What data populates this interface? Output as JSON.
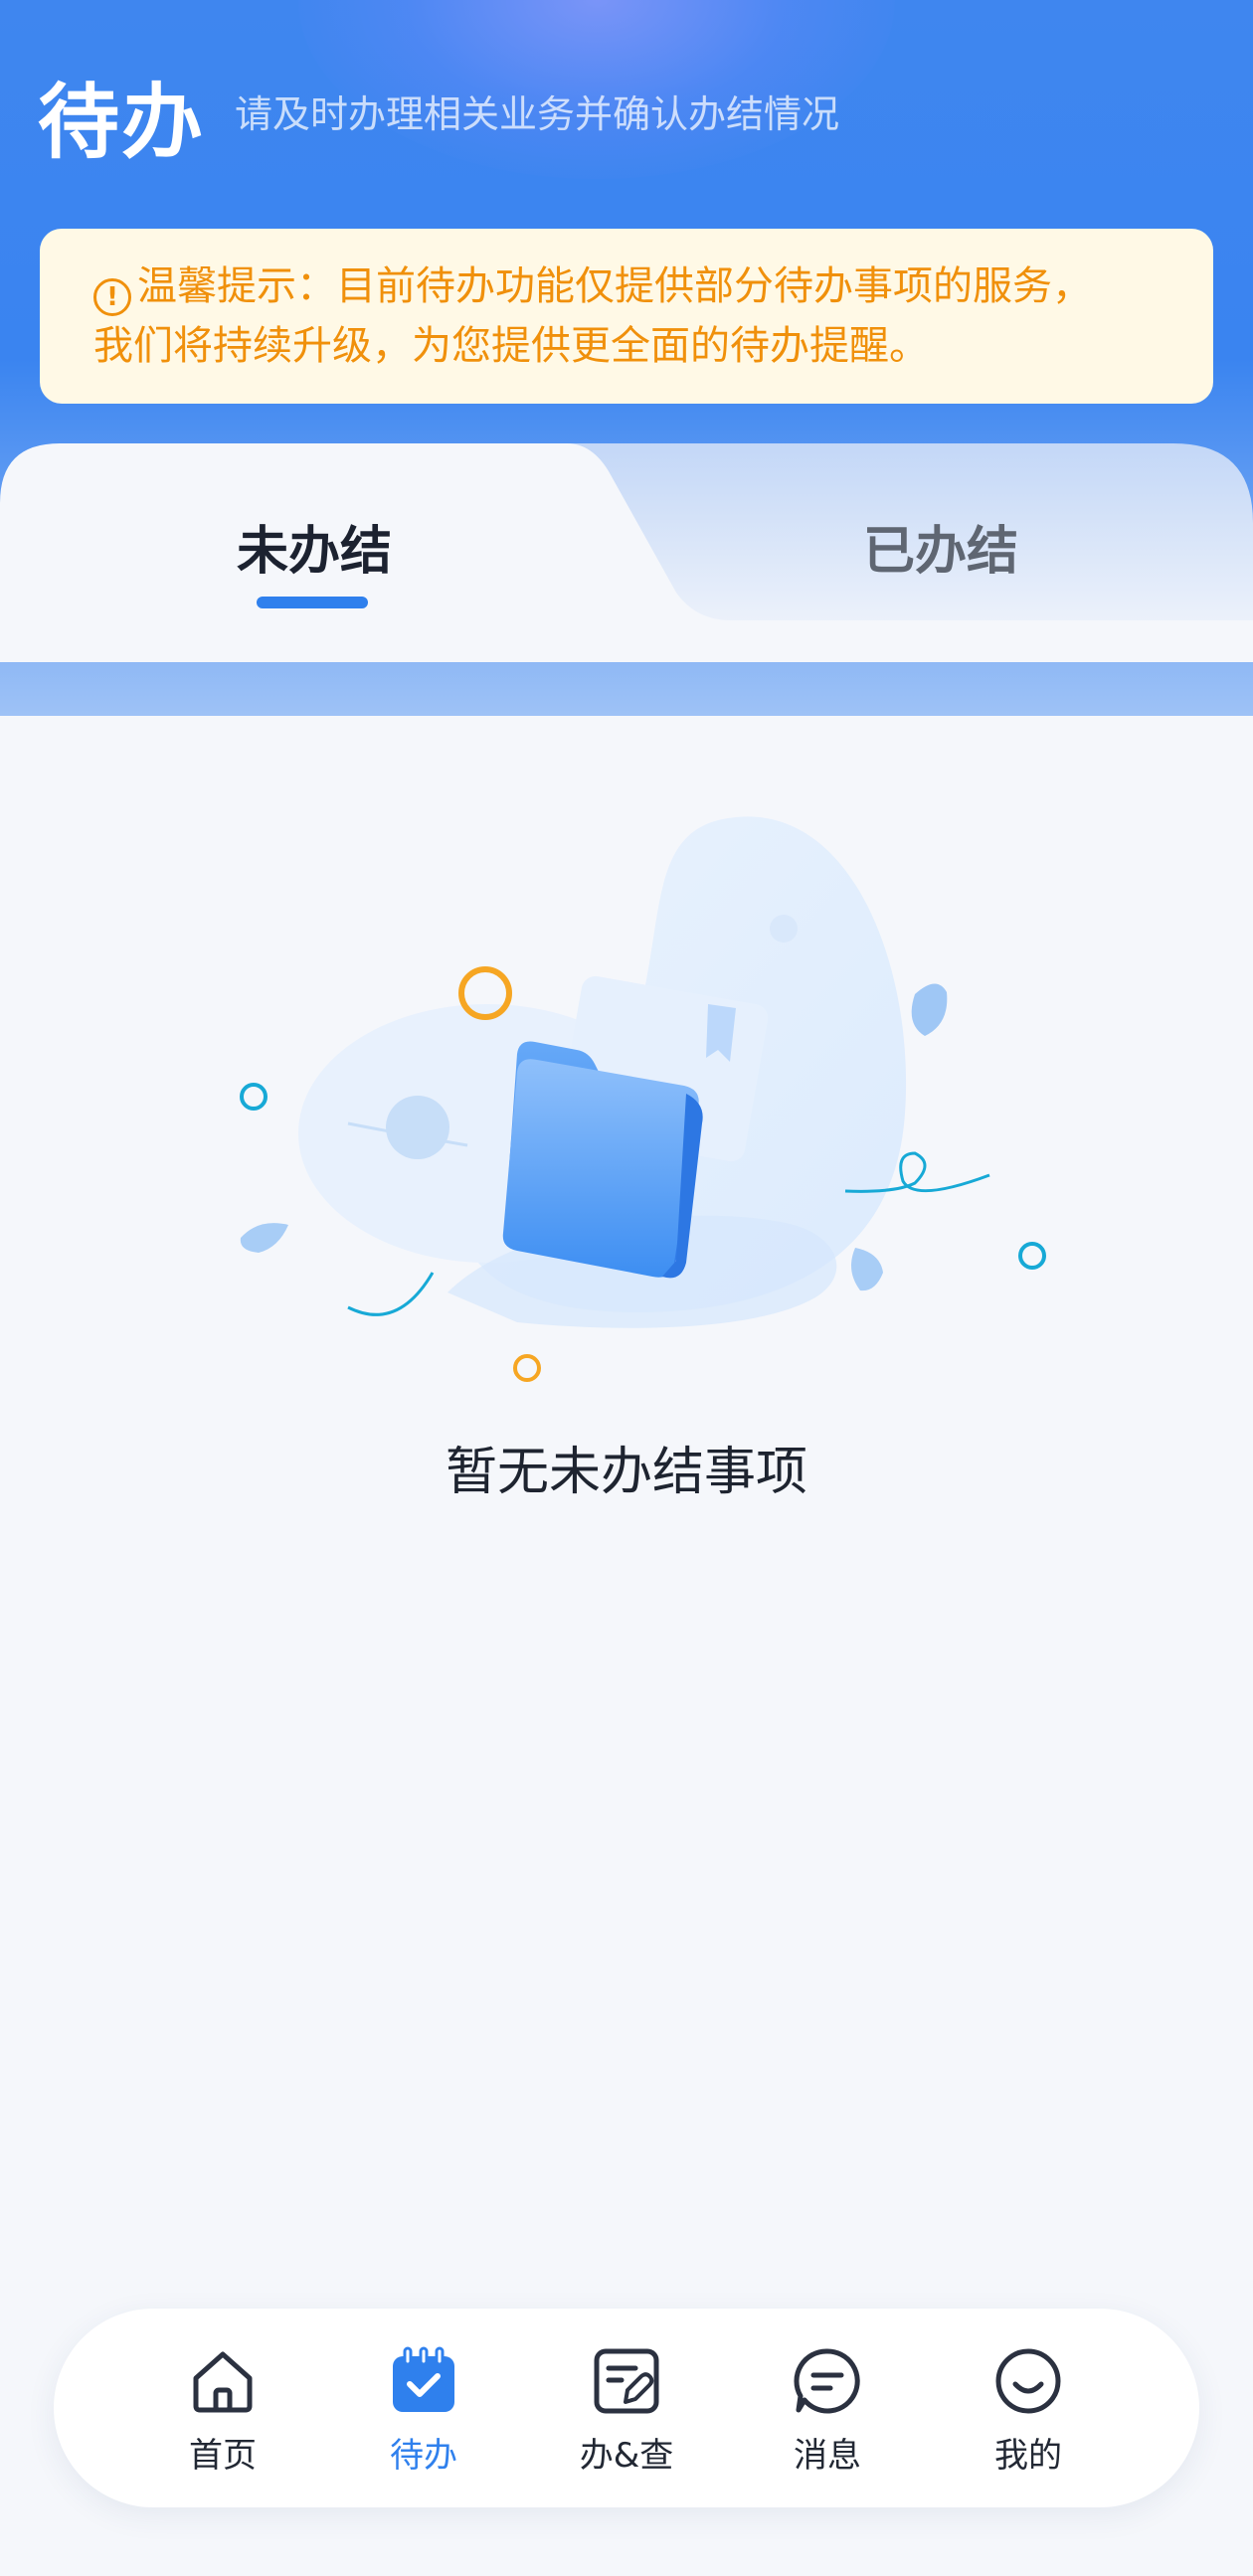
{
  "header": {
    "title": "待办",
    "subtitle": "请及时办理相关业务并确认办结情况"
  },
  "notice": {
    "icon": "info-icon",
    "line1": "温馨提示：目前待办功能仅提供部分待办事项的服务，",
    "line2": "我们将持续升级，为您提供更全面的待办提醒。",
    "color": "#f0900b"
  },
  "tabs": [
    {
      "label": "未办结",
      "active": true
    },
    {
      "label": "已办结",
      "active": false
    }
  ],
  "empty_state": {
    "icon": "empty-folder-illustration",
    "text": "暂无未办结事项"
  },
  "bottom_nav": [
    {
      "label": "首页",
      "icon": "home-icon",
      "active": false
    },
    {
      "label": "待办",
      "icon": "todo-calendar-icon",
      "active": true
    },
    {
      "label": "办&查",
      "icon": "handle-query-icon",
      "active": false
    },
    {
      "label": "消息",
      "icon": "message-icon",
      "active": false
    },
    {
      "label": "我的",
      "icon": "profile-smile-icon",
      "active": false
    }
  ],
  "colors": {
    "accent": "#2f80ed",
    "header_blue": "#3f86ef",
    "background": "#f5f7fb"
  }
}
